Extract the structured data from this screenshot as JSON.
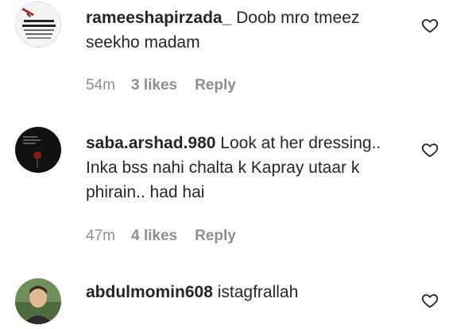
{
  "comments": [
    {
      "username": "rameeshapirzada_",
      "text": "Doob mro tmeez seekho madam",
      "time": "54m",
      "likes": "3 likes",
      "reply": "Reply",
      "avatar_icon": "text-quote-avatar-icon",
      "avatar_text": "Life is the most difficult exam."
    },
    {
      "username": "saba.arshad.980",
      "text": "Look at her dressing.. Inka bss nahi chalta k Kapray utaar k phirain.. had hai",
      "time": "47m",
      "likes": "4 likes",
      "reply": "Reply",
      "avatar_icon": "dark-rose-avatar-icon"
    },
    {
      "username": "abdulmomin608",
      "text": "istagfrallah",
      "avatar_icon": "man-portrait-avatar-icon"
    }
  ],
  "colors": {
    "primary_text": "#262626",
    "secondary_text": "#8e8e8e"
  }
}
